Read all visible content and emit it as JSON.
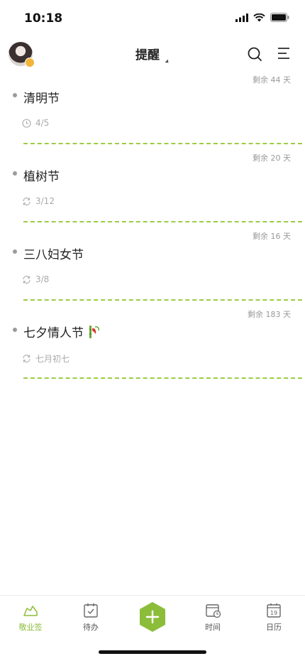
{
  "status_bar": {
    "time": "10:18"
  },
  "header": {
    "title": "提醒"
  },
  "reminders": [
    {
      "name": "清明节",
      "date": "4/5",
      "remaining": "剩余 44 天",
      "icon": "clock-icon"
    },
    {
      "name": "植树节",
      "date": "3/12",
      "remaining": "剩余 20 天",
      "icon": "repeat-icon"
    },
    {
      "name": "三八妇女节",
      "date": "3/8",
      "remaining": "剩余 16 天",
      "icon": "repeat-icon"
    },
    {
      "name": "七夕情人节",
      "date": "七月初七",
      "remaining": "剩余 183 天",
      "icon": "repeat-icon",
      "emoji": "bamboo-icon"
    }
  ],
  "tabbar": {
    "items": [
      {
        "label": "敬业签",
        "icon": "cloud-note-icon",
        "active": true
      },
      {
        "label": "待办",
        "icon": "todo-icon",
        "active": false
      },
      {
        "label": "时间",
        "icon": "time-calendar-icon",
        "active": false
      },
      {
        "label": "日历",
        "icon": "calendar-icon",
        "active": false,
        "day": "19"
      }
    ]
  },
  "colors": {
    "accent": "#8cbd3a",
    "divider": "#9ecb47",
    "text": "#222222",
    "muted": "#999999"
  }
}
